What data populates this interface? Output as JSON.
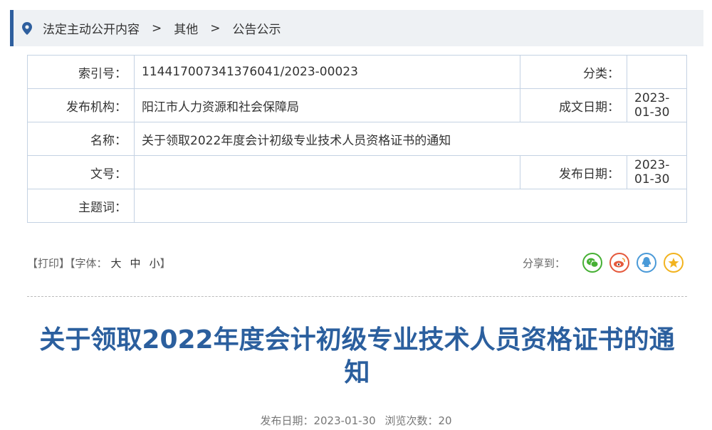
{
  "breadcrumb": [
    "法定主动公开内容",
    "其他",
    "公告公示"
  ],
  "breadcrumb_separator": ">",
  "info": {
    "index_label": "索引号：",
    "index_value": "114417007341376041/2023-00023",
    "category_label": "分类：",
    "category_value": "",
    "publisher_label": "发布机构：",
    "publisher_value": "阳江市人力资源和社会保障局",
    "created_label": "成文日期：",
    "created_value": "2023-01-30",
    "name_label": "名称：",
    "name_value": "关于领取2022年度会计初级专业技术人员资格证书的通知",
    "doc_no_label": "文号：",
    "doc_no_value": "",
    "publish_label": "发布日期：",
    "publish_value": "2023-01-30",
    "keywords_label": "主题词：",
    "keywords_value": ""
  },
  "tools": {
    "print": "【打印】",
    "font_prefix": "【字体：",
    "font_large": "大",
    "font_medium": "中",
    "font_small": "小",
    "font_suffix": "】",
    "share_label": "分享到："
  },
  "share_icons": [
    "wechat-icon",
    "weibo-icon",
    "qq-icon",
    "favorite-star-icon"
  ],
  "article": {
    "title": "关于领取2022年度会计初级专业技术人员资格证书的通知",
    "publish_date": "发布日期：2023-01-30",
    "views": "浏览次数：20"
  },
  "colors": {
    "accent": "#2e5f9e",
    "title": "#2b5f9e",
    "border": "#c4d2e3",
    "breadcrumb_bg": "#eef1f4"
  }
}
